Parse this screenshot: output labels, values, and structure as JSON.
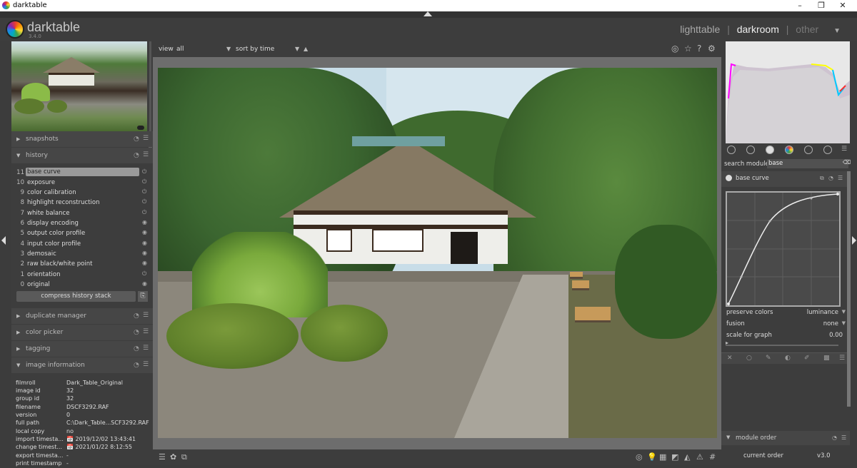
{
  "window": {
    "title": "darktable",
    "controls": [
      "–",
      "❐",
      "✕"
    ]
  },
  "header": {
    "app_name": "darktable",
    "version": "3.4.0",
    "views": [
      "lighttable",
      "darkroom",
      "other"
    ],
    "separator": "|",
    "active_view": "darkroom"
  },
  "left_panel": {
    "sections": {
      "snapshots": "snapshots",
      "history": "history",
      "duplicate_manager": "duplicate manager",
      "color_picker": "color picker",
      "tagging": "tagging",
      "image_information": "image information"
    },
    "history": [
      {
        "num": "11",
        "name": "base curve",
        "selected": true
      },
      {
        "num": "10",
        "name": "exposure"
      },
      {
        "num": "9",
        "name": "color calibration"
      },
      {
        "num": "8",
        "name": "highlight reconstruction"
      },
      {
        "num": "7",
        "name": "white balance"
      },
      {
        "num": "6",
        "name": "display encoding"
      },
      {
        "num": "5",
        "name": "output color profile"
      },
      {
        "num": "4",
        "name": "input color profile"
      },
      {
        "num": "3",
        "name": "demosaic"
      },
      {
        "num": "2",
        "name": "raw black/white point"
      },
      {
        "num": "1",
        "name": "orientation"
      },
      {
        "num": "0",
        "name": "original"
      }
    ],
    "compress_label": "compress history stack",
    "image_information": [
      {
        "k": "filmroll",
        "v": "Dark_Table_Original"
      },
      {
        "k": "image id",
        "v": "32"
      },
      {
        "k": "group id",
        "v": "32"
      },
      {
        "k": "filename",
        "v": "DSCF3292.RAF"
      },
      {
        "k": "version",
        "v": "0"
      },
      {
        "k": "full path",
        "v": "C:\\Dark_Table...SCF3292.RAF"
      },
      {
        "k": "local copy",
        "v": "no"
      },
      {
        "k": "import timesta...",
        "v": "📅 2019/12/02 13:43:41"
      },
      {
        "k": "change timest...",
        "v": "📅 2021/01/22 8:12:55"
      },
      {
        "k": "export timesta...",
        "v": "-"
      },
      {
        "k": "print timestamp",
        "v": "-"
      }
    ]
  },
  "center": {
    "view_label": "view",
    "view_value": "all",
    "sort_label": "sort by",
    "sort_value": "time"
  },
  "right_panel": {
    "search_label": "search module",
    "search_value": "base",
    "module_title": "base curve",
    "params": [
      {
        "k": "preserve colors",
        "v": "luminance"
      },
      {
        "k": "fusion",
        "v": "none"
      },
      {
        "k": "scale for graph",
        "v": "0.00"
      }
    ],
    "module_order_label": "module order",
    "current_order_label": "current order",
    "current_order_value": "v3.0"
  },
  "colors": {
    "panel_bg": "#3d3d3d",
    "section_bg": "#464646",
    "center_bg": "#6d6d6d"
  }
}
